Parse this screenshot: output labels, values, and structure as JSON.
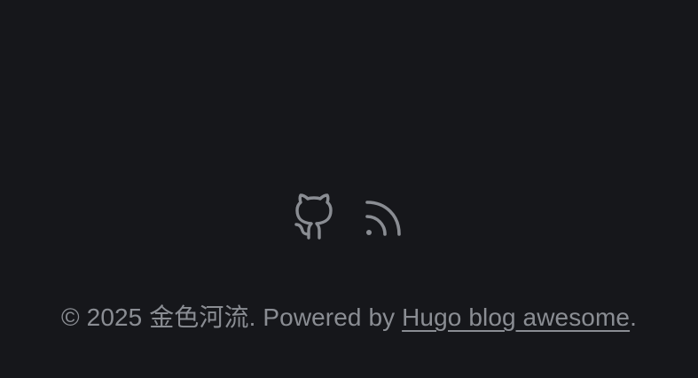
{
  "social": [
    {
      "name": "GitHub",
      "icon": "github-icon"
    },
    {
      "name": "RSS",
      "icon": "rss-icon"
    }
  ],
  "footer": {
    "copyright_prefix": "© 2025 金色河流. Powered by ",
    "link_text": "Hugo blog awesome",
    "suffix": "."
  },
  "colors": {
    "background": "#16171b",
    "text": "#8a8d93"
  }
}
